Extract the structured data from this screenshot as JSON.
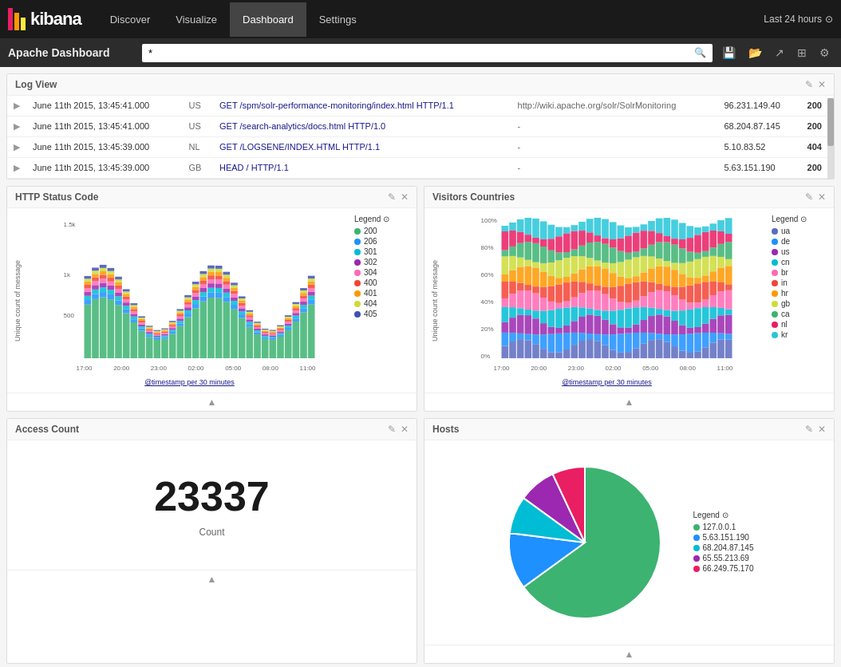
{
  "nav": {
    "logo_text": "kibana",
    "items": [
      {
        "label": "Discover",
        "active": false
      },
      {
        "label": "Visualize",
        "active": false
      },
      {
        "label": "Dashboard",
        "active": true
      },
      {
        "label": "Settings",
        "active": false
      }
    ],
    "time_filter": "Last 24 hours",
    "time_icon": "⊙"
  },
  "subheader": {
    "page_title": "Apache Dashboard",
    "search_placeholder": "*",
    "toolbar_icons": [
      "📄",
      "📊",
      "↗",
      "⊞",
      "⚙"
    ]
  },
  "log_view": {
    "title": "Log View",
    "rows": [
      {
        "timestamp": "June 11th 2015, 13:45:41.000",
        "country": "US",
        "request": "GET /spm/solr-performance-monitoring/index.html HTTP/1.1",
        "referrer": "http://wiki.apache.org/solr/SolrMonitoring",
        "ip": "96.231.149.40",
        "status": "200"
      },
      {
        "timestamp": "June 11th 2015, 13:45:41.000",
        "country": "US",
        "request": "GET /search-analytics/docs.html HTTP/1.0",
        "referrer": "-",
        "ip": "68.204.87.145",
        "status": "200"
      },
      {
        "timestamp": "June 11th 2015, 13:45:39.000",
        "country": "NL",
        "request": "GET /LOGSENE/INDEX.HTML HTTP/1.1",
        "referrer": "-",
        "ip": "5.10.83.52",
        "status": "404"
      },
      {
        "timestamp": "June 11th 2015, 13:45:39.000",
        "country": "GB",
        "request": "HEAD / HTTP/1.1",
        "referrer": "-",
        "ip": "5.63.151.190",
        "status": "200"
      }
    ]
  },
  "http_status": {
    "title": "HTTP Status Code",
    "y_label": "Unique count of message",
    "x_label": "@timestamp per 30 minutes",
    "x_ticks": [
      "17:00",
      "20:00",
      "23:00",
      "02:00",
      "05:00",
      "08:00",
      "11:00"
    ],
    "y_ticks": [
      "1.5k",
      "1k",
      "500"
    ],
    "legend": [
      {
        "label": "200",
        "color": "#3cb371"
      },
      {
        "label": "206",
        "color": "#1E90FF"
      },
      {
        "label": "301",
        "color": "#00bcd4"
      },
      {
        "label": "302",
        "color": "#9c27b0"
      },
      {
        "label": "304",
        "color": "#ff69b4"
      },
      {
        "label": "400",
        "color": "#f44336"
      },
      {
        "label": "401",
        "color": "#ff9800"
      },
      {
        "label": "404",
        "color": "#cddc39"
      },
      {
        "label": "405",
        "color": "#3f51b5"
      }
    ]
  },
  "visitors_countries": {
    "title": "Visitors Countries",
    "y_label": "Unique count of message",
    "x_label": "@timestamp per 30 minutes",
    "x_ticks": [
      "17:00",
      "20:00",
      "23:00",
      "02:00",
      "05:00",
      "08:00",
      "11:00"
    ],
    "y_ticks": [
      "100%",
      "80%",
      "60%",
      "40%",
      "20%",
      "0%"
    ],
    "legend": [
      {
        "label": "ua",
        "color": "#5c6bc0"
      },
      {
        "label": "de",
        "color": "#1E90FF"
      },
      {
        "label": "us",
        "color": "#9c27b0"
      },
      {
        "label": "cn",
        "color": "#00bcd4"
      },
      {
        "label": "br",
        "color": "#ff69b4"
      },
      {
        "label": "in",
        "color": "#f44336"
      },
      {
        "label": "hr",
        "color": "#ff9800"
      },
      {
        "label": "gb",
        "color": "#cddc39"
      },
      {
        "label": "ca",
        "color": "#3cb371"
      },
      {
        "label": "nl",
        "color": "#e91e63"
      },
      {
        "label": "kr",
        "color": "#26c6da"
      }
    ]
  },
  "access_count": {
    "title": "Access Count",
    "count": "23337",
    "label": "Count"
  },
  "hosts": {
    "title": "Hosts",
    "legend": [
      {
        "label": "127.0.0.1",
        "color": "#3cb371"
      },
      {
        "label": "5.63.151.190",
        "color": "#1E90FF"
      },
      {
        "label": "68.204.87.145",
        "color": "#00bcd4"
      },
      {
        "label": "65.55.213.69",
        "color": "#9c27b0"
      },
      {
        "label": "66.249.75.170",
        "color": "#e91e63"
      }
    ],
    "slices": [
      {
        "label": "127.0.0.1",
        "value": 65,
        "color": "#3cb371"
      },
      {
        "label": "5.63.151.190",
        "value": 12,
        "color": "#1E90FF"
      },
      {
        "label": "68.204.87.145",
        "value": 8,
        "color": "#00bcd4"
      },
      {
        "label": "65.55.213.69",
        "value": 8,
        "color": "#9c27b0"
      },
      {
        "label": "66.249.75.170",
        "value": 7,
        "color": "#e91e63"
      }
    ]
  },
  "collapse_button": "▲"
}
